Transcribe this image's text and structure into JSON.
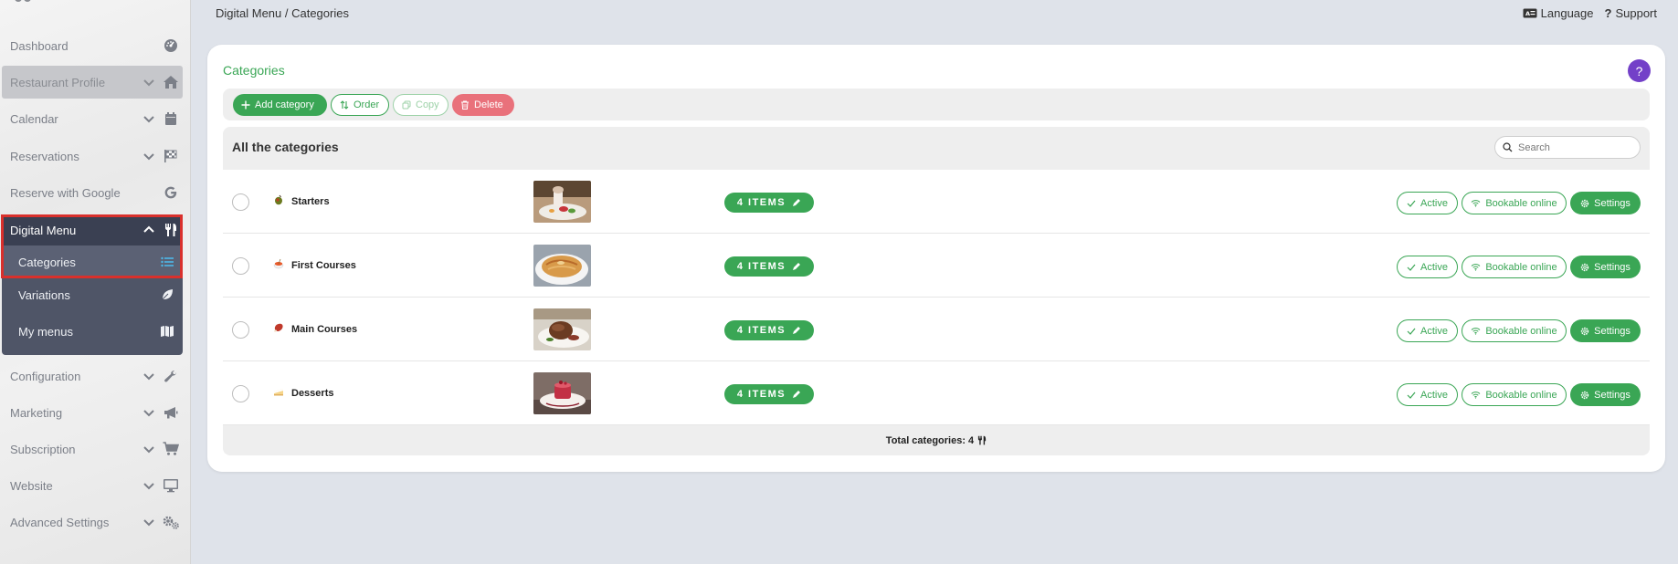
{
  "sidebar": {
    "items": [
      {
        "label": "Dashboard",
        "icon": "dashboard-gauge-icon"
      },
      {
        "label": "Restaurant Profile",
        "icon": "home-icon"
      },
      {
        "label": "Calendar",
        "icon": "calendar-icon"
      },
      {
        "label": "Reservations",
        "icon": "flag-checkered-icon"
      },
      {
        "label": "Reserve with Google",
        "icon": "google-icon"
      },
      {
        "label": "Digital Menu",
        "icon": "utensils-icon"
      },
      {
        "label": "Configuration",
        "icon": "wrench-icon"
      },
      {
        "label": "Marketing",
        "icon": "megaphone-icon"
      },
      {
        "label": "Subscription",
        "icon": "cart-icon"
      },
      {
        "label": "Website",
        "icon": "monitor-icon"
      },
      {
        "label": "Advanced Settings",
        "icon": "cogs-icon"
      }
    ],
    "digital_menu_sub": [
      {
        "label": "Categories",
        "icon": "list-icon"
      },
      {
        "label": "Variations",
        "icon": "leaf-icon"
      },
      {
        "label": "My menus",
        "icon": "map-icon"
      }
    ]
  },
  "header": {
    "breadcrumb": "Digital Menu / Categories",
    "language": "Language",
    "support": "Support"
  },
  "card": {
    "title": "Categories",
    "help": "?",
    "toolbar": {
      "add": "Add category",
      "order": "Order",
      "copy": "Copy",
      "delete": "Delete"
    },
    "table_title": "All the categories",
    "search_placeholder": "Search",
    "rows": [
      {
        "name": "Starters",
        "items": "4 ITEMS"
      },
      {
        "name": "First Courses",
        "items": "4 ITEMS"
      },
      {
        "name": "Main Courses",
        "items": "4 ITEMS"
      },
      {
        "name": "Desserts",
        "items": "4 ITEMS"
      }
    ],
    "row_actions": {
      "active": "Active",
      "bookable": "Bookable online",
      "settings": "Settings"
    },
    "footer": "Total categories: 4"
  },
  "colors": {
    "accent_green": "#3aa655",
    "delete_red": "#e9717b",
    "sidebar_dark": "#3a4052",
    "sidebar_sub": "#4f5567",
    "help_purple": "#7340c8",
    "highlight_red": "#d9302c"
  }
}
